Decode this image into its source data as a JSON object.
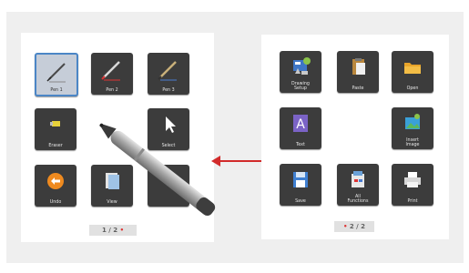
{
  "left_page": {
    "tiles": [
      {
        "id": "pen1",
        "label": "Pen 1",
        "icon": "pen-icon",
        "selected": true
      },
      {
        "id": "pen2",
        "label": "Pen 2",
        "icon": "pen-icon",
        "selected": false
      },
      {
        "id": "pen3",
        "label": "Pen 3",
        "icon": "pen-icon",
        "selected": false
      },
      {
        "id": "eraser",
        "label": "Eraser",
        "icon": "eraser-icon",
        "selected": false
      },
      {
        "id": "select",
        "label": "Select",
        "icon": "pointer-icon",
        "selected": false
      },
      {
        "id": "undo",
        "label": "Undo",
        "icon": "undo-icon",
        "selected": false
      },
      {
        "id": "view",
        "label": "View",
        "icon": "view-icon",
        "selected": false
      },
      {
        "id": "hidden",
        "label": "",
        "icon": "tool-icon",
        "selected": false
      }
    ],
    "pager": {
      "text": "1 / 2",
      "marker": "•"
    }
  },
  "right_page": {
    "tiles": [
      {
        "id": "drawing-setup",
        "label": "Drawing\nSetup",
        "icon": "drawing-setup-icon"
      },
      {
        "id": "paste",
        "label": "Paste",
        "icon": "paste-icon"
      },
      {
        "id": "open",
        "label": "Open",
        "icon": "folder-icon"
      },
      {
        "id": "text",
        "label": "Text",
        "icon": "text-icon"
      },
      {
        "id": "insert-image",
        "label": "Insert\nImage",
        "icon": "image-icon"
      },
      {
        "id": "save",
        "label": "Save",
        "icon": "save-icon"
      },
      {
        "id": "all-functions",
        "label": "All\nFunctions",
        "icon": "all-functions-icon"
      },
      {
        "id": "print",
        "label": "Print",
        "icon": "printer-icon"
      }
    ],
    "pager": {
      "text": "2 / 2",
      "marker": "•"
    }
  },
  "colors": {
    "tile_bg": "#3c3c3c",
    "selected_border": "#4b86c6",
    "arrow": "#d22b2b",
    "panel_bg": "#ffffff",
    "canvas_bg": "#efefef"
  }
}
